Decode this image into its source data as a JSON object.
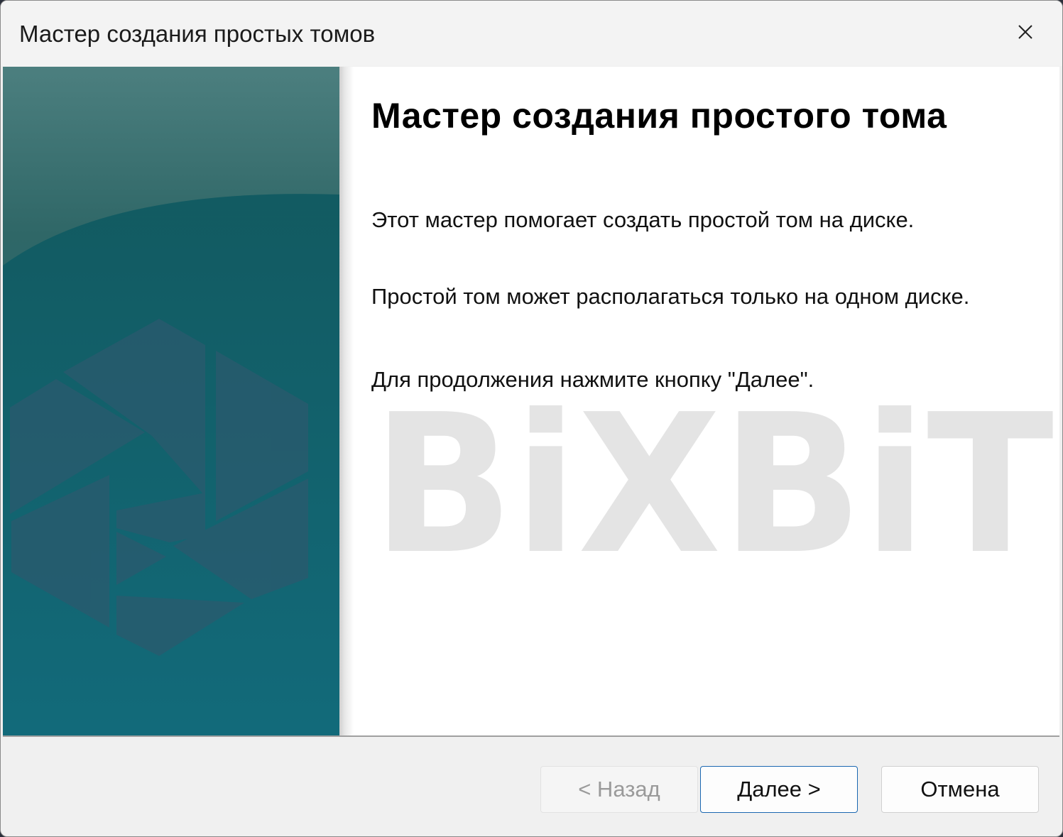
{
  "window": {
    "title": "Мастер создания простых томов",
    "close_icon": "close-icon"
  },
  "main": {
    "heading": "Мастер создания простого тома",
    "paragraph_1": "Этот мастер помогает создать простой том на диске.",
    "paragraph_2": "Простой том может располагаться только на одном диске.",
    "paragraph_3": "Для продолжения нажмите кнопку \"Далее\"."
  },
  "watermark": {
    "text": "BiXBiT",
    "color": "#e4e4e4"
  },
  "buttons": {
    "back": "< Назад",
    "next": "Далее >",
    "cancel": "Отмена"
  },
  "colors": {
    "side_top": "#4a7e7e",
    "side_bottom": "#126a7a",
    "next_border": "#1a67b0"
  }
}
